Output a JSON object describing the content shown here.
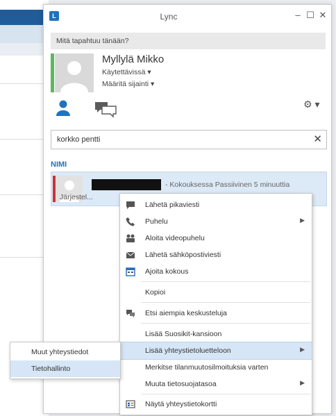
{
  "window": {
    "title": "Lync",
    "minimize": "–",
    "maximize": "☐",
    "close": "✕"
  },
  "status_message_placeholder": "Mitä tapahtuu tänään?",
  "user": {
    "name": "Myllylä Mikko",
    "status": "Käytettävissä ▾",
    "location": "Määritä sijainti ▾",
    "presence_color": "#5cb85c"
  },
  "options_label": "⚙ ▾",
  "search": {
    "value": "korkko pentti",
    "clear": "✕"
  },
  "results_header": "NIMI",
  "result": {
    "meeting_status": "- Kokouksessa Passiivinen 5 minuuttia",
    "line2": "Järjestel...",
    "presence_color": "#cc3333"
  },
  "context_menu": {
    "items": [
      {
        "label": "Lähetä pikaviesti",
        "icon": "chat-icon"
      },
      {
        "label": "Puhelu",
        "icon": "phone-icon",
        "submenu": true
      },
      {
        "label": "Aloita videopuhelu",
        "icon": "video-icon"
      },
      {
        "label": "Lähetä sähköpostiviesti",
        "icon": "email-icon"
      },
      {
        "label": "Ajoita kokous",
        "icon": "calendar-icon"
      },
      {
        "label": "Kopioi"
      },
      {
        "label": "Etsi aiempia keskusteluja",
        "icon": "history-icon"
      },
      {
        "label": "Lisää Suosikit-kansioon"
      },
      {
        "label": "Lisää yhteystietoluetteloon",
        "submenu": true,
        "highlighted": true
      },
      {
        "label": "Merkitse tilanmuutosilmoituksia varten"
      },
      {
        "label": "Muuta tietosuojatasoa",
        "submenu": true
      },
      {
        "label": "Näytä yhteystietokortti",
        "icon": "contact-card-icon"
      }
    ]
  },
  "submenu": {
    "items": [
      {
        "label": "Muut yhteystiedot"
      },
      {
        "label": "Tietohallinto",
        "highlighted": true
      }
    ]
  },
  "colors": {
    "accent": "#1e73be",
    "highlight": "#d6e6f6"
  }
}
